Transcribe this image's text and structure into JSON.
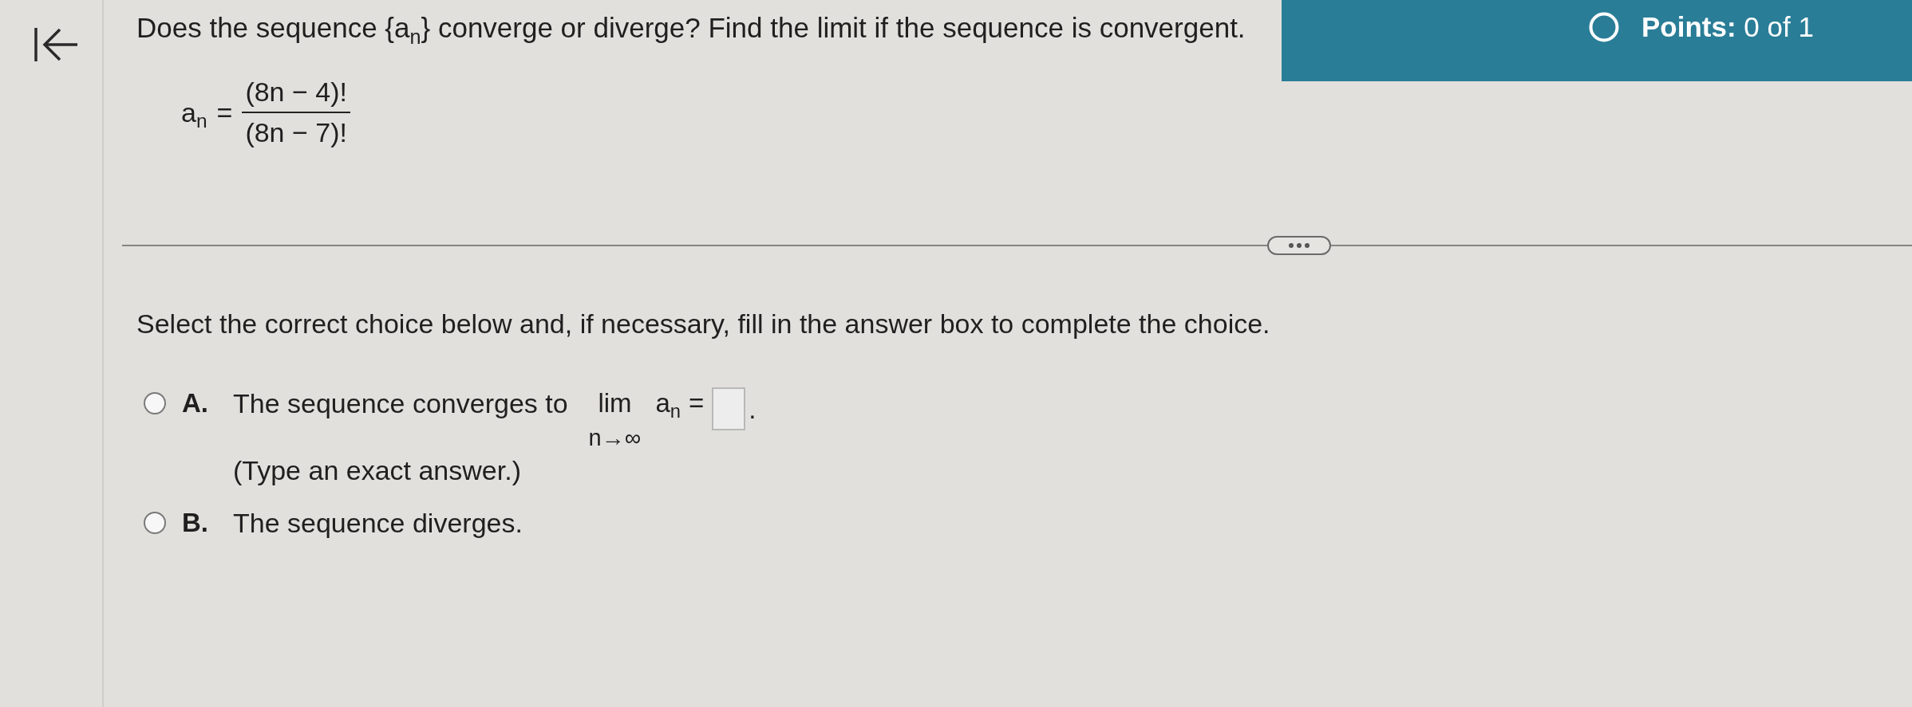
{
  "header": {
    "points": "**Points:** 0 of 1"
  },
  "question": {
    "text": "Does the sequence {a$_{n}$} converge or diverge? Find the limit if the sequence is convergent.",
    "formula": {
      "lhs": "a$_{n}$",
      "equals": "=",
      "numerator": "(8n − 4)!",
      "denominator": "(8n − 7)!"
    }
  },
  "instruction": "Select the correct choice below and, if necessary, fill in the answer box to complete the choice.",
  "choices": [
    {
      "kind": "limit",
      "letter": "A.",
      "selected": false,
      "text": "The sequence converges to",
      "limit": {
        "operator": "lim",
        "subscript": "n→∞",
        "term": "a$_{n}$",
        "equals": "=",
        "end": "."
      },
      "hint": "(Type an exact answer.)"
    },
    {
      "kind": "plain",
      "letter": "B.",
      "selected": false,
      "text": "The sequence diverges."
    }
  ]
}
